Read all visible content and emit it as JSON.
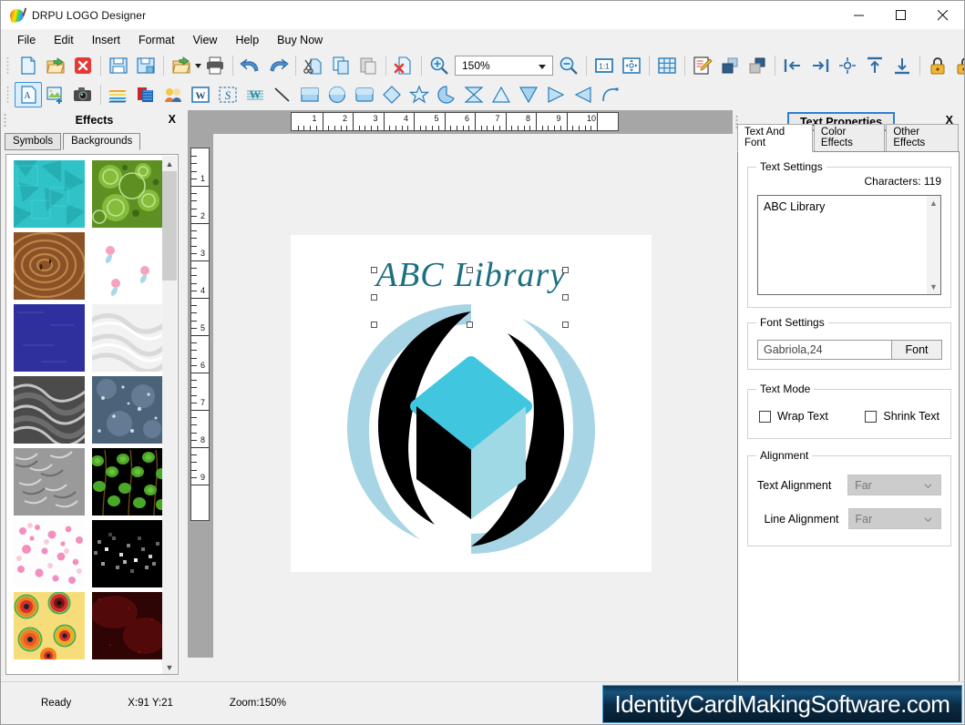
{
  "window": {
    "title": "DRPU LOGO Designer",
    "icon": "palette-icon",
    "controls": {
      "minimize": "minimize-icon",
      "maximize": "maximize-icon",
      "close": "close-icon"
    }
  },
  "menu": {
    "items": [
      "File",
      "Edit",
      "Insert",
      "Format",
      "View",
      "Help",
      "Buy Now"
    ]
  },
  "toolbar_row1": {
    "zoom_value": "150%",
    "items": [
      "new-document-icon",
      "open-folder-icon",
      "close-document-icon",
      "sep",
      "save-icon",
      "save-as-icon",
      "sep",
      "export-icon",
      "export-dropdown-icon",
      "print-icon",
      "sep",
      "undo-icon",
      "redo-icon",
      "sep",
      "cut-icon",
      "copy-icon",
      "paste-icon",
      "sep",
      "delete-icon",
      "sep",
      "zoom-in-icon",
      "zoom-combo",
      "zoom-out-icon",
      "sep",
      "actual-size-icon",
      "fit-page-icon",
      "sep",
      "grid-icon",
      "sep",
      "edit-properties-icon",
      "bring-to-front-icon",
      "send-to-back-icon",
      "sep",
      "align-left-icon",
      "align-right-icon",
      "align-center-icon",
      "align-top-icon",
      "align-bottom-icon",
      "sep",
      "lock-icon",
      "unlock-icon"
    ]
  },
  "toolbar_row2": {
    "items": [
      "add-text-icon",
      "add-image-icon",
      "capture-image-icon",
      "sep",
      "barcode-icon",
      "watermark-icon",
      "signature-icon",
      "word-art-icon",
      "shape-text-icon",
      "text-lines-icon",
      "line-tool-icon",
      "rectangle-tool-icon",
      "ellipse-tool-icon",
      "rounded-rect-tool-icon",
      "diamond-tool-icon",
      "star-tool-icon",
      "arc-tool-icon",
      "butterfly-shape-icon",
      "triangle-up-icon",
      "triangle-down-icon",
      "triangle-right-icon",
      "triangle-left-icon",
      "curve-tool-icon"
    ],
    "selected": "add-text-icon"
  },
  "left_panel": {
    "title": "Effects",
    "close_label": "X",
    "tabs": [
      {
        "label": "Symbols",
        "active": false
      },
      {
        "label": "Backgrounds",
        "active": true
      }
    ],
    "thumbnails": [
      {
        "name": "teal-geometric-pattern",
        "colors": [
          "#2fc2c6",
          "#23a3ab",
          "#56d4d0"
        ]
      },
      {
        "name": "green-circles-pattern",
        "colors": [
          "#4c8b1f",
          "#8cc63f",
          "#b5dd78"
        ]
      },
      {
        "name": "brown-wood-swirl",
        "colors": [
          "#7b4521",
          "#a96b35",
          "#c9924f"
        ]
      },
      {
        "name": "pink-flowers-white",
        "colors": [
          "#ffffff",
          "#f3a4c2",
          "#a9d8e6"
        ]
      },
      {
        "name": "blue-paper-texture",
        "colors": [
          "#2f2f9e",
          "#3a3ab0",
          "#26268a"
        ]
      },
      {
        "name": "white-silk-texture",
        "colors": [
          "#f2f2f2",
          "#e3e3e3",
          "#d6d6d6"
        ]
      },
      {
        "name": "grey-waves-texture",
        "colors": [
          "#4b4b4b",
          "#8e8e8e",
          "#cfcfcf"
        ]
      },
      {
        "name": "blue-bokeh-texture",
        "colors": [
          "#3f5a72",
          "#6e87a0",
          "#b7c9d8"
        ]
      },
      {
        "name": "grey-feather-texture",
        "colors": [
          "#8e8e8e",
          "#bbbbbb",
          "#6d6d6d"
        ]
      },
      {
        "name": "green-leaves-black",
        "colors": [
          "#000000",
          "#4aa828",
          "#7ac943"
        ]
      },
      {
        "name": "pink-blossom-white",
        "colors": [
          "#ffffff",
          "#f06ba8",
          "#f8b6d0"
        ]
      },
      {
        "name": "black-pixel-lights",
        "colors": [
          "#000000",
          "#8b8b8b",
          "#ffffff"
        ]
      },
      {
        "name": "orange-flowers-yellow",
        "colors": [
          "#f6dd7a",
          "#f07f1a",
          "#d32f2f"
        ]
      },
      {
        "name": "dark-red-texture",
        "colors": [
          "#3a0505",
          "#6b0d0d",
          "#220202"
        ]
      }
    ],
    "scrollbar": {
      "up": "scroll-up-icon",
      "down": "scroll-down-icon"
    }
  },
  "workspace": {
    "horizontal_ruler_marks": [
      1,
      2,
      3,
      4,
      5,
      6,
      7,
      8,
      9,
      10
    ],
    "vertical_ruler_marks": [
      1,
      2,
      3,
      4,
      5,
      6,
      7,
      8,
      9
    ],
    "canvas": {
      "logo_text": "ABC Library",
      "logo_text_color": "#1c6f80",
      "logo_shape_colors": {
        "light_ring": "#a8d5e5",
        "dark_crescent": "#000000",
        "cube_top": "#41c6df",
        "cube_right": "#9fd9e6",
        "cube_left": "#000000"
      },
      "selection_handles": 8
    }
  },
  "right_panel": {
    "title": "Text Properties",
    "close_label": "X",
    "tabs": [
      {
        "label": "Text And Font",
        "active": true
      },
      {
        "label": "Color Effects",
        "active": false
      },
      {
        "label": "Other Effects",
        "active": false
      }
    ],
    "text_settings": {
      "group_label": "Text Settings",
      "character_count_label": "Characters: 119",
      "text_value": "ABC Library"
    },
    "font_settings": {
      "group_label": "Font Settings",
      "font_value": "Gabriola,24",
      "font_button_label": "Font"
    },
    "text_mode": {
      "group_label": "Text Mode",
      "wrap_text_label": "Wrap Text",
      "wrap_text_checked": false,
      "shrink_text_label": "Shrink Text",
      "shrink_text_checked": false
    },
    "alignment": {
      "group_label": "Alignment",
      "text_alignment_label": "Text Alignment",
      "text_alignment_value": "Far",
      "line_alignment_label": "Line Alignment",
      "line_alignment_value": "Far"
    }
  },
  "status_bar": {
    "ready_text": "Ready",
    "coordinates": "X:91  Y:21",
    "zoom": "Zoom:150%",
    "banner_text": "IdentityCardMakingSoftware.com"
  }
}
